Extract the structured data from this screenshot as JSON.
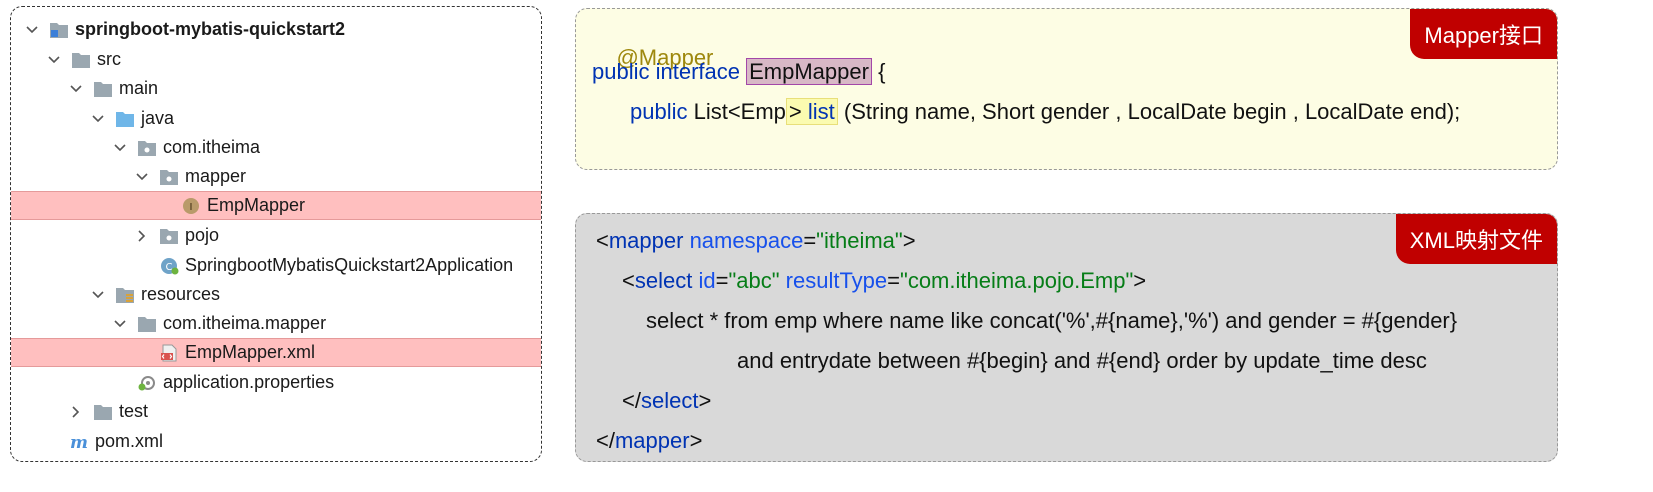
{
  "tree": {
    "root": "springboot-mybatis-quickstart2",
    "src": "src",
    "main": "main",
    "java": "java",
    "pkg": "com.itheima",
    "mapper": "mapper",
    "emp_mapper": "EmpMapper",
    "pojo": "pojo",
    "app_class": "SpringbootMybatisQuickstart2Application",
    "resources": "resources",
    "res_pkg": "com.itheima.mapper",
    "emp_mapper_xml": "EmpMapper.xml",
    "app_props": "application.properties",
    "test": "test",
    "pom": "pom.xml"
  },
  "mapper_code": {
    "badge": "Mapper接口",
    "annotation": "@Mapper",
    "kw_public_interface": "public interface",
    "class_name": "EmpMapper",
    "open_brace": " {",
    "kw_public": "public",
    "return_type": " List<Emp",
    "gt": ">",
    "method_name": " list",
    "params": " (String name, Short gender , LocalDate begin , LocalDate end);",
    "close_brace": "}"
  },
  "xml_code": {
    "badge": "XML映射文件",
    "lt": "<",
    "gt": ">",
    "close_lt": "</",
    "mapper_tag": "mapper",
    "namespace_attr": " namespace",
    "eq": "=",
    "namespace_val": "\"itheima\"",
    "select_tag": "select",
    "id_attr": " id",
    "id_val": "\"abc\"",
    "result_attr": " resultType",
    "result_val": "\"com.itheima.pojo.Emp\"",
    "sql_line1": "select * from emp where name like concat('%',#{name},'%') and gender = #{gender}",
    "sql_line2": "and entrydate between #{begin} and #{end} order by update_time desc"
  },
  "colors": {
    "highlight_row": "#ffbfbf",
    "badge_bg": "#c00000",
    "keyword": "#0033b3",
    "annotation": "#9e880d",
    "string": "#067d17"
  }
}
